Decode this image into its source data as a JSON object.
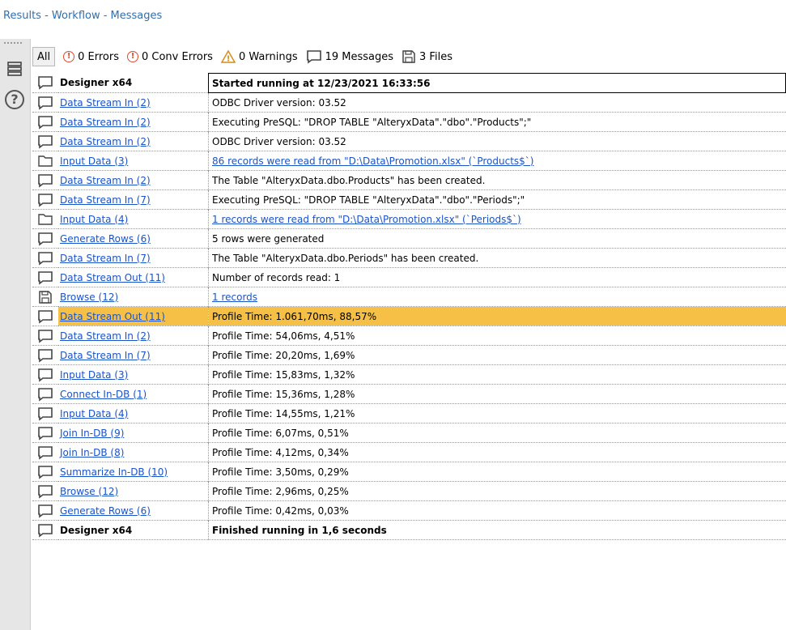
{
  "window": {
    "title": "Results - Workflow - Messages"
  },
  "filters": {
    "all": "All",
    "errors": "0 Errors",
    "conv_errors": "0 Conv Errors",
    "warnings": "0 Warnings",
    "messages": "19 Messages",
    "files": "3 Files"
  },
  "rows": [
    {
      "icon": "message",
      "tool": "Designer x64",
      "message": "Started running at 12/23/2021 16:33:56",
      "bold": true,
      "first": true
    },
    {
      "icon": "message",
      "tool": "Data Stream In (2)",
      "message": "ODBC Driver version: 03.52"
    },
    {
      "icon": "message",
      "tool": "Data Stream In (2)",
      "message": "Executing PreSQL: \"DROP TABLE \"AlteryxData\".\"dbo\".\"Products\";\""
    },
    {
      "icon": "message",
      "tool": "Data Stream In (2)",
      "message": "ODBC Driver version: 03.52"
    },
    {
      "icon": "folder",
      "tool": "Input Data (3)",
      "message": "86 records were read from \"D:\\Data\\Promotion.xlsx\" (`Products$`)",
      "msg_link": true
    },
    {
      "icon": "message",
      "tool": "Data Stream In (2)",
      "message": "The Table \"AlteryxData.dbo.Products\" has been created."
    },
    {
      "icon": "message",
      "tool": "Data Stream In (7)",
      "message": "Executing PreSQL: \"DROP TABLE \"AlteryxData\".\"dbo\".\"Periods\";\""
    },
    {
      "icon": "folder",
      "tool": "Input Data (4)",
      "message": "1 records were read from \"D:\\Data\\Promotion.xlsx\" (`Periods$`)",
      "msg_link": true
    },
    {
      "icon": "message",
      "tool": "Generate Rows (6)",
      "message": "5 rows were generated"
    },
    {
      "icon": "message",
      "tool": "Data Stream In (7)",
      "message": "The Table \"AlteryxData.dbo.Periods\" has been created."
    },
    {
      "icon": "message",
      "tool": "Data Stream Out (11)",
      "message": "Number of records read: 1"
    },
    {
      "icon": "file",
      "tool": "Browse (12)",
      "message": "1 records",
      "msg_link": true
    },
    {
      "icon": "message",
      "tool": "Data Stream Out (11)",
      "message": "Profile Time: 1.061,70ms, 88,57%",
      "highlight": true
    },
    {
      "icon": "message",
      "tool": "Data Stream In (2)",
      "message": "Profile Time: 54,06ms, 4,51%"
    },
    {
      "icon": "message",
      "tool": "Data Stream In (7)",
      "message": "Profile Time: 20,20ms, 1,69%"
    },
    {
      "icon": "message",
      "tool": "Input Data (3)",
      "message": "Profile Time: 15,83ms, 1,32%"
    },
    {
      "icon": "message",
      "tool": "Connect In-DB (1)",
      "message": "Profile Time: 15,36ms, 1,28%"
    },
    {
      "icon": "message",
      "tool": "Input Data (4)",
      "message": "Profile Time: 14,55ms, 1,21%"
    },
    {
      "icon": "message",
      "tool": "Join In-DB (9)",
      "message": "Profile Time: 6,07ms, 0,51%"
    },
    {
      "icon": "message",
      "tool": "Join In-DB (8)",
      "message": "Profile Time: 4,12ms, 0,34%"
    },
    {
      "icon": "message",
      "tool": "Summarize In-DB (10)",
      "message": "Profile Time: 3,50ms, 0,29%"
    },
    {
      "icon": "message",
      "tool": "Browse (12)",
      "message": "Profile Time: 2,96ms, 0,25%"
    },
    {
      "icon": "message",
      "tool": "Generate Rows (6)",
      "message": "Profile Time: 0,42ms, 0,03%"
    },
    {
      "icon": "message",
      "tool": "Designer x64",
      "message": "Finished running in 1,6 seconds",
      "bold": true
    }
  ],
  "colors": {
    "link": "#1a53c9",
    "highlight": "#f6c046",
    "title": "#2f6fb0",
    "error": "#e04a2a",
    "warning": "#d98a1a"
  }
}
